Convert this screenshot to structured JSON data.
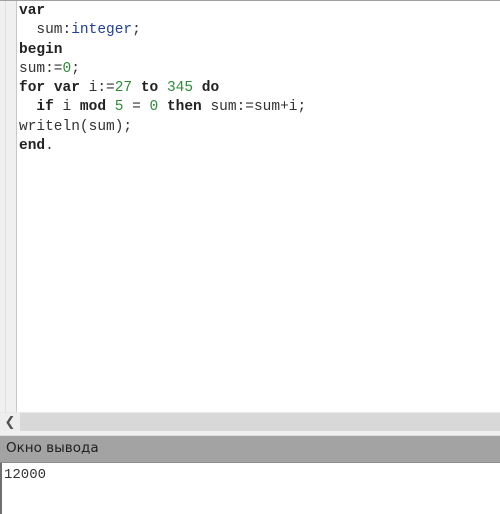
{
  "editor": {
    "lines": [
      [
        {
          "t": "var",
          "c": "kw"
        }
      ],
      [
        {
          "t": "  sum:",
          "c": ""
        },
        {
          "t": "integer",
          "c": "type"
        },
        {
          "t": ";",
          "c": ""
        }
      ],
      [
        {
          "t": "begin",
          "c": "kw"
        }
      ],
      [
        {
          "t": "sum:=",
          "c": ""
        },
        {
          "t": "0",
          "c": "num"
        },
        {
          "t": ";",
          "c": ""
        }
      ],
      [
        {
          "t": "for",
          "c": "kw"
        },
        {
          "t": " ",
          "c": ""
        },
        {
          "t": "var",
          "c": "kw"
        },
        {
          "t": " i:=",
          "c": ""
        },
        {
          "t": "27",
          "c": "num"
        },
        {
          "t": " ",
          "c": ""
        },
        {
          "t": "to",
          "c": "kw"
        },
        {
          "t": " ",
          "c": ""
        },
        {
          "t": "345",
          "c": "num"
        },
        {
          "t": " ",
          "c": ""
        },
        {
          "t": "do",
          "c": "kw"
        }
      ],
      [
        {
          "t": "  ",
          "c": ""
        },
        {
          "t": "if",
          "c": "kw"
        },
        {
          "t": " i ",
          "c": ""
        },
        {
          "t": "mod",
          "c": "kw"
        },
        {
          "t": " ",
          "c": ""
        },
        {
          "t": "5",
          "c": "num"
        },
        {
          "t": " = ",
          "c": ""
        },
        {
          "t": "0",
          "c": "num"
        },
        {
          "t": " ",
          "c": ""
        },
        {
          "t": "then",
          "c": "kw"
        },
        {
          "t": " sum:=sum+i;",
          "c": ""
        }
      ],
      [
        {
          "t": "writeln(sum);",
          "c": ""
        }
      ],
      [
        {
          "t": "end",
          "c": "kw"
        },
        {
          "t": ".",
          "c": ""
        }
      ]
    ]
  },
  "scrollbar": {
    "left_arrow_icon": "chevron-left-icon",
    "left_arrow_glyph": "❮"
  },
  "output_panel": {
    "title": "Окно вывода",
    "text": "12000"
  },
  "colors": {
    "keyword": "#222222",
    "type": "#1f3f9a",
    "number": "#2f8a3a",
    "header_bg": "#a3a3a3"
  }
}
